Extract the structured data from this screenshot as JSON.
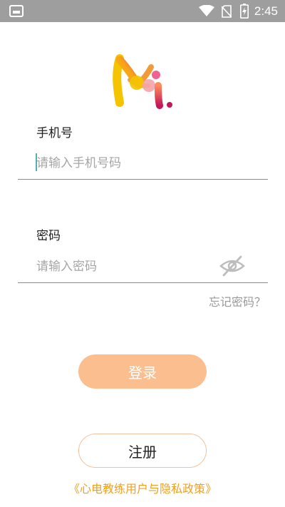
{
  "status_bar": {
    "time": "2:45",
    "icons": [
      "screen-icon",
      "wifi-icon",
      "no-sim-icon",
      "battery-charging-icon"
    ]
  },
  "login_form": {
    "phone_label": "手机号",
    "phone_placeholder": "请输入手机号码",
    "password_label": "密码",
    "password_placeholder": "请输入密码",
    "forgot_password": "忘记密码？",
    "login_button": "登录",
    "register_button": "注册",
    "policy_link": "《心电教练用户与隐私政策》"
  },
  "colors": {
    "status_bar": "#9e9e9e",
    "login_button": "#fbbf8f",
    "register_border": "#f3c39c",
    "policy_link": "#f0a020",
    "cursor": "#4fb3b0"
  }
}
